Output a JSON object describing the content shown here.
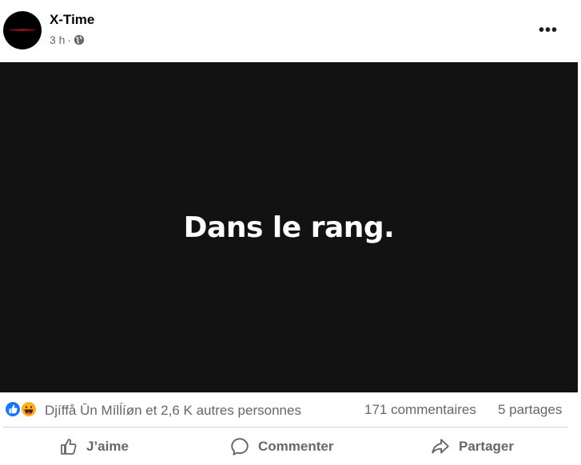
{
  "post": {
    "page_name": "X-Time",
    "time": "3 h",
    "separator": "·",
    "audience_icon": "globe-icon",
    "image_text": "Dans le rang.",
    "more_icon": "more-options-icon",
    "more_label": "•••"
  },
  "reactions": {
    "icons": [
      "like-reaction-icon",
      "haha-reaction-icon"
    ],
    "reactors": "Djíffå Ūn Mílĺíøn et 2,6 K autres personnes",
    "comments": "171 commentaires",
    "shares": "5 partages"
  },
  "actions": {
    "like": "J’aime",
    "comment": "Commenter",
    "share": "Partager"
  },
  "colors": {
    "accent": "#1877f2",
    "image_bg": "#121212",
    "secondary_text": "#65676b"
  }
}
